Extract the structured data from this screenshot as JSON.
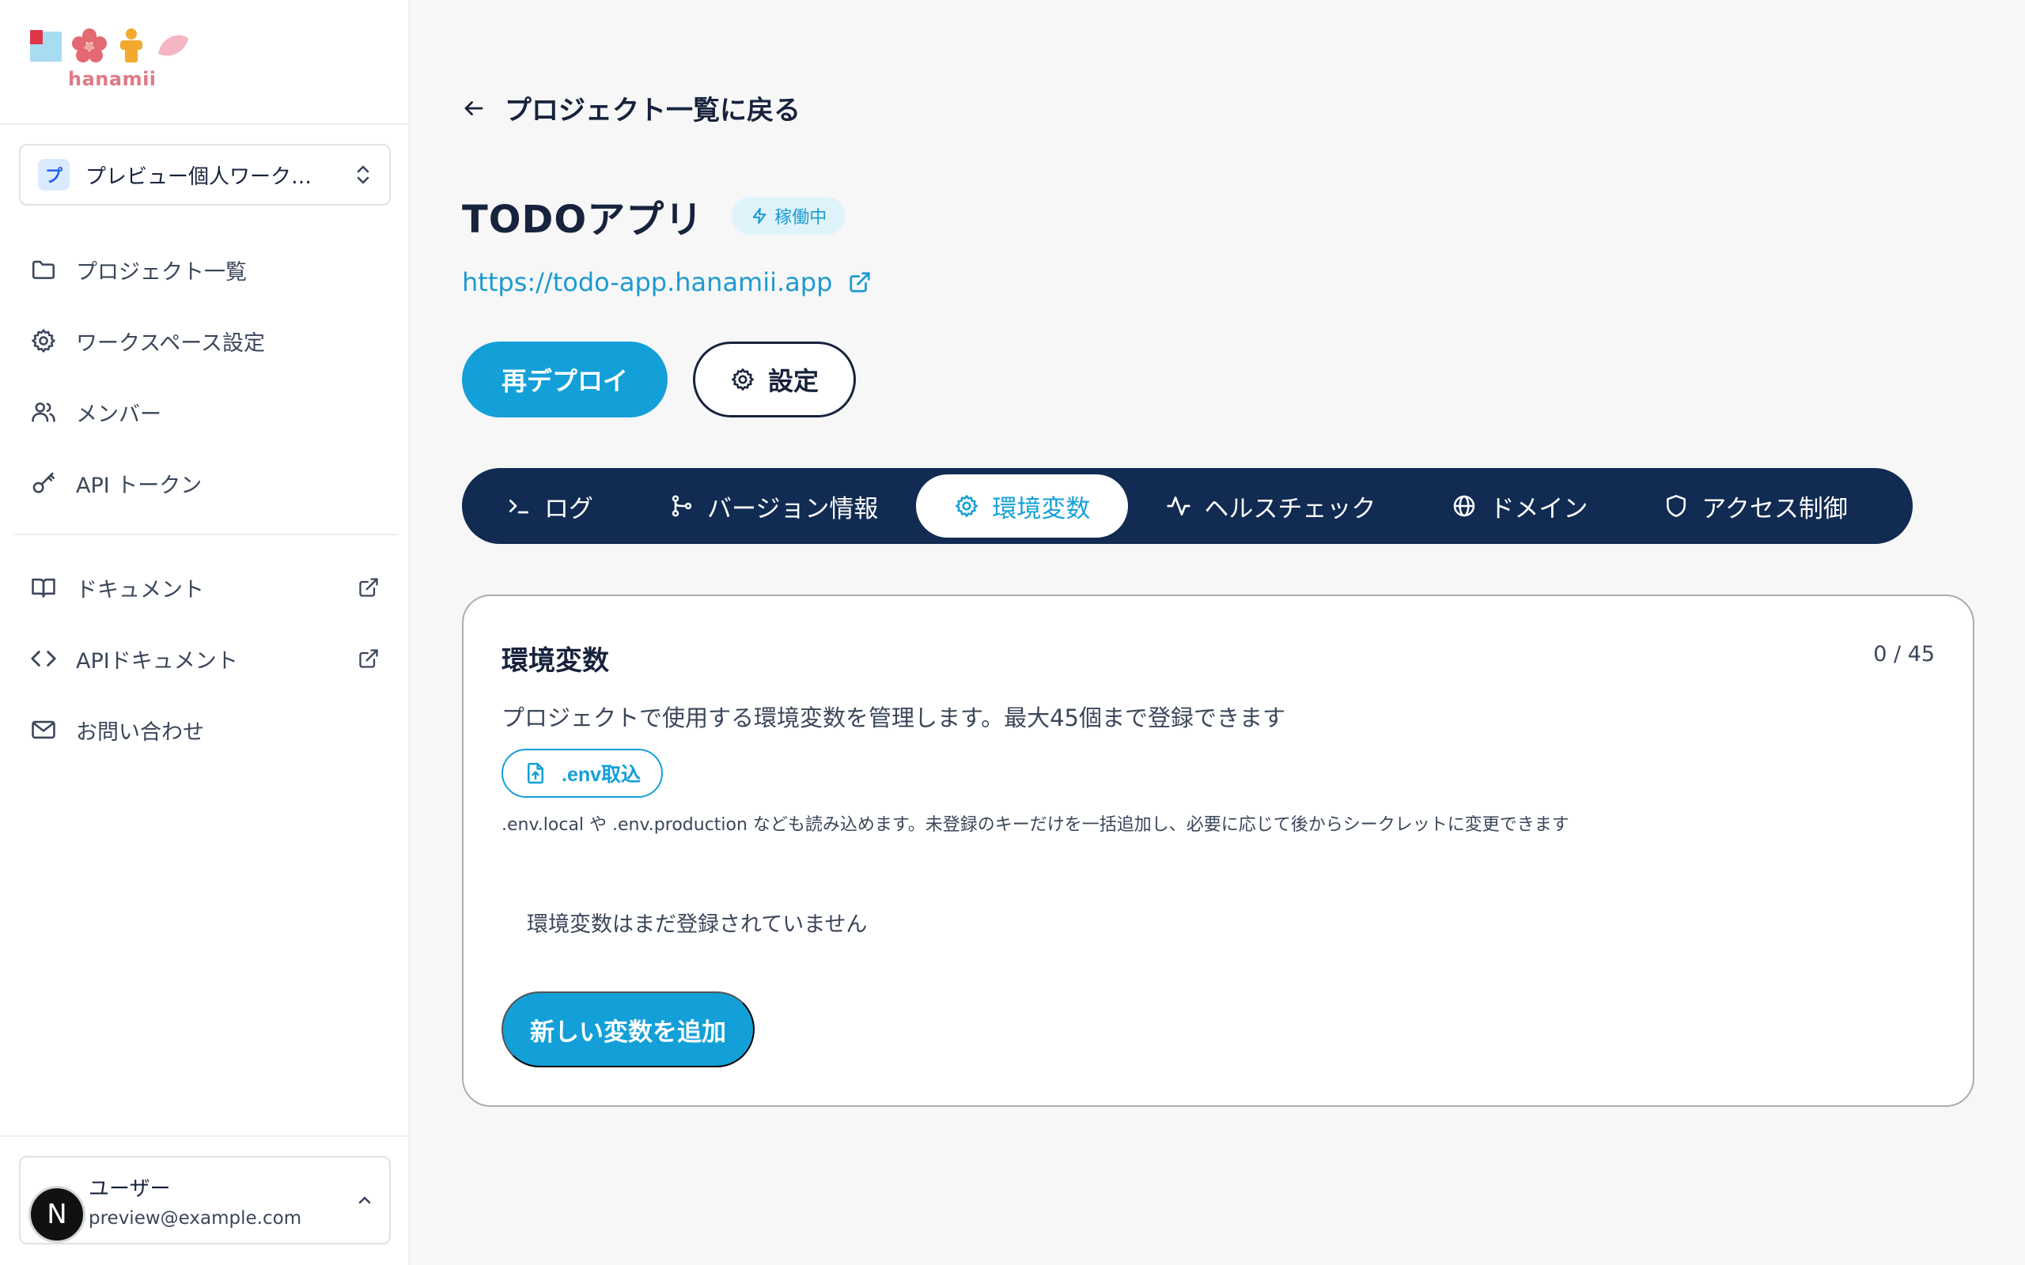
{
  "brand": {
    "name": "hanamii"
  },
  "workspace": {
    "initial": "プ",
    "name": "プレビュー個人ワーク…"
  },
  "sidebar": {
    "nav": [
      {
        "label": "プロジェクト一覧",
        "icon": "folder-icon"
      },
      {
        "label": "ワークスペース設定",
        "icon": "gear-icon"
      },
      {
        "label": "メンバー",
        "icon": "users-icon"
      },
      {
        "label": "API トークン",
        "icon": "key-icon"
      }
    ],
    "links": [
      {
        "label": "ドキュメント",
        "icon": "book-icon",
        "external": true
      },
      {
        "label": "APIドキュメント",
        "icon": "code-icon",
        "external": true
      },
      {
        "label": "お問い合わせ",
        "icon": "mail-icon",
        "external": false
      }
    ]
  },
  "user": {
    "initial": "N",
    "name": "ユーザー",
    "email": "preview@example.com"
  },
  "header": {
    "back_label": "プロジェクト一覧に戻る",
    "title": "TODOアプリ",
    "status": "稼働中",
    "url": "https://todo-app.hanamii.app"
  },
  "actions": {
    "redeploy": "再デプロイ",
    "settings": "設定"
  },
  "tabs": [
    {
      "label": "ログ",
      "icon": "terminal-icon",
      "active": false
    },
    {
      "label": "バージョン情報",
      "icon": "git-branch-icon",
      "active": false
    },
    {
      "label": "環境変数",
      "icon": "gear-icon",
      "active": true
    },
    {
      "label": "ヘルスチェック",
      "icon": "activity-icon",
      "active": false
    },
    {
      "label": "ドメイン",
      "icon": "globe-icon",
      "active": false
    },
    {
      "label": "アクセス制御",
      "icon": "shield-icon",
      "active": false
    }
  ],
  "env": {
    "title": "環境変数",
    "count": "0 / 45",
    "description": "プロジェクトで使用する環境変数を管理します。最大45個まで登録できます",
    "import_label": ".env取込",
    "import_help": ".env.local や .env.production なども読み込めます。未登録のキーだけを一括追加し、必要に応じて後からシークレットに変更できます",
    "empty": "環境変数はまだ登録されていません",
    "add_label": "新しい変数を追加"
  },
  "colors": {
    "accent": "#13a0d8",
    "navy": "#112b52",
    "text": "#17233c",
    "muted": "#3b465a",
    "background": "#f7f7f8",
    "badge_bg": "#dff3fb"
  }
}
